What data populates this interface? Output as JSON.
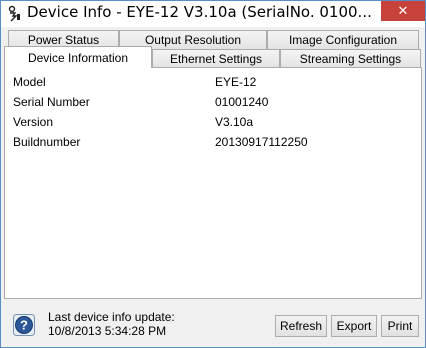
{
  "window": {
    "title": "Device Info - EYE-12 V3.10a (SerialNo. 0100...",
    "close_glyph": "✕"
  },
  "tabs": {
    "row_back": [
      "Power Status",
      "Output Resolution",
      "Image Configuration"
    ],
    "row_front": [
      "Device Information",
      "Ethernet Settings",
      "Streaming Settings"
    ],
    "active": "Device Information"
  },
  "device_info": {
    "rows": [
      {
        "label": "Model",
        "value": "EYE-12"
      },
      {
        "label": "Serial Number",
        "value": "01001240"
      },
      {
        "label": "Version",
        "value": "V3.10a"
      },
      {
        "label": "Buildnumber",
        "value": "20130917112250"
      }
    ]
  },
  "footer": {
    "update_label": "Last device info update:",
    "update_value": "10/8/2013 5:34:28 PM",
    "help_icon": "help-icon",
    "buttons": {
      "refresh": "Refresh",
      "export": "Export",
      "print": "Print"
    }
  },
  "colors": {
    "close_button": "#c7423b",
    "window_border": "#5b8cc4",
    "help_icon": "#2b5797"
  }
}
